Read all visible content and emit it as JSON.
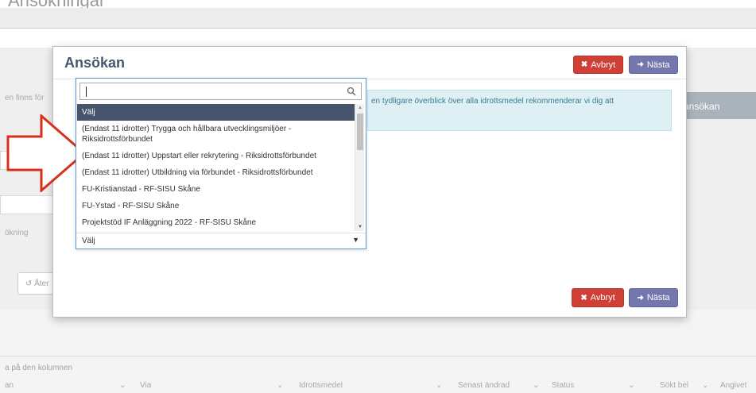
{
  "page": {
    "heading": "Ansökningar",
    "left_text": "en finns för",
    "okning_text": "ökning",
    "reset_label": "Åter",
    "ansokan_button": "ansökan",
    "sort_hint": "a på den kolumnen",
    "column_headers": [
      "an",
      "Via",
      "Idrottsmedel",
      "Senast ändrad",
      "Status",
      "Sökt bel",
      "Angivet"
    ]
  },
  "modal": {
    "title": "Ansökan",
    "cancel_label": "Avbryt",
    "next_label": "Nästa",
    "info_text": "en tydligare överblick över alla idrottsmedel rekommenderar vi dig att"
  },
  "dropdown": {
    "search_value": "",
    "options": [
      "Välj",
      "(Endast 11 idrotter) Trygga och hållbara utvecklingsmiljöer - Riksidrottsförbundet",
      "(Endast 11 idrotter) Uppstart eller rekrytering - Riksidrottsförbundet",
      "(Endast 11 idrotter) Utbildning via förbundet - Riksidrottsförbundet",
      "FU-Kristianstad - RF-SISU Skåne",
      "FU-Ystad - RF-SISU Skåne",
      "Projektstöd IF Anläggning 2022 - RF-SISU Skåne"
    ],
    "selected_value": "Välj"
  },
  "colors": {
    "title": "#46556d",
    "danger": "#cf3f35",
    "primary": "#7477ad",
    "selected_option": "#46556d",
    "arrow": "#d9301e"
  }
}
